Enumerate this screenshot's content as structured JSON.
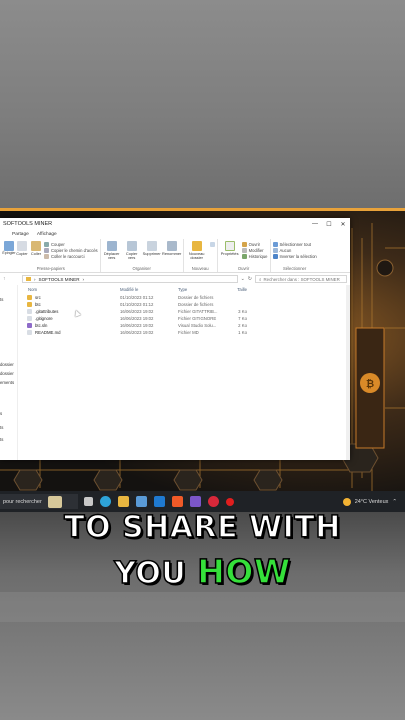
{
  "window": {
    "title": "SOFTOOLS MINER",
    "controls": [
      "—",
      "☐",
      "✕"
    ]
  },
  "ribbon_tabs": [
    "Partage",
    "Affichage"
  ],
  "ribbon": {
    "clipboard": {
      "label": "Presse-papiers",
      "big": [
        "Épingler",
        "Copier",
        "Coller"
      ],
      "small": [
        "Couper",
        "Copier le chemin d'accès",
        "Coller le raccourci"
      ]
    },
    "organize": {
      "label": "Organiser",
      "big": [
        "Déplacer vers",
        "Copier vers",
        "Supprimer",
        "Renommer"
      ]
    },
    "new": {
      "label": "Nouveau",
      "big": [
        "Nouveau dossier"
      ]
    },
    "open": {
      "label": "Ouvrir",
      "big": [
        "Propriétés"
      ],
      "small": [
        "Ouvrir",
        "Modifier",
        "Historique"
      ]
    },
    "select": {
      "label": "Sélectionner",
      "small": [
        "Sélectionner tout",
        "Aucun",
        "Inverser la sélection"
      ]
    }
  },
  "address": {
    "path": "SOFTOOLS MINER",
    "search_placeholder": "Rechercher dans : SOFTOOLS MINER"
  },
  "nav_pane": [
    "ts",
    "dossier",
    "dossier",
    "ements",
    "s",
    "ts",
    "ts"
  ],
  "columns": {
    "name": "Nom",
    "date": "Modifié le",
    "type": "Type",
    "size": "Taille"
  },
  "files": [
    {
      "name": "src",
      "date": "01/10/2023 01:12",
      "type": "Dossier de fichiers",
      "size": "",
      "kind": "folder"
    },
    {
      "name": "btc",
      "date": "01/10/2023 01:12",
      "type": "Dossier de fichiers",
      "size": "",
      "kind": "folder"
    },
    {
      "name": ".gitattributes",
      "date": "16/06/2023 19:02",
      "type": "Fichier GITATTRIB...",
      "size": "3 Ko",
      "kind": "file"
    },
    {
      "name": ".gitignore",
      "date": "16/06/2023 19:02",
      "type": "Fichier GITIGNORE",
      "size": "7 Ko",
      "kind": "file"
    },
    {
      "name": "btc.sln",
      "date": "16/06/2023 19:02",
      "type": "Visual Studio Solu...",
      "size": "2 Ko",
      "kind": "sln"
    },
    {
      "name": "README.md",
      "date": "16/06/2023 19:02",
      "type": "Fichier MD",
      "size": "1 Ko",
      "kind": "file"
    }
  ],
  "taskbar": {
    "search": "pour rechercher",
    "weather": "24°C  Venteux"
  },
  "caption": {
    "line1": "TO SHARE WITH",
    "line2_word1": "YOU",
    "line2_word2": "HOW"
  },
  "colors": {
    "accent_orange": "#e8a23a",
    "caption_green": "#35e03a",
    "folder": "#e8b640"
  }
}
